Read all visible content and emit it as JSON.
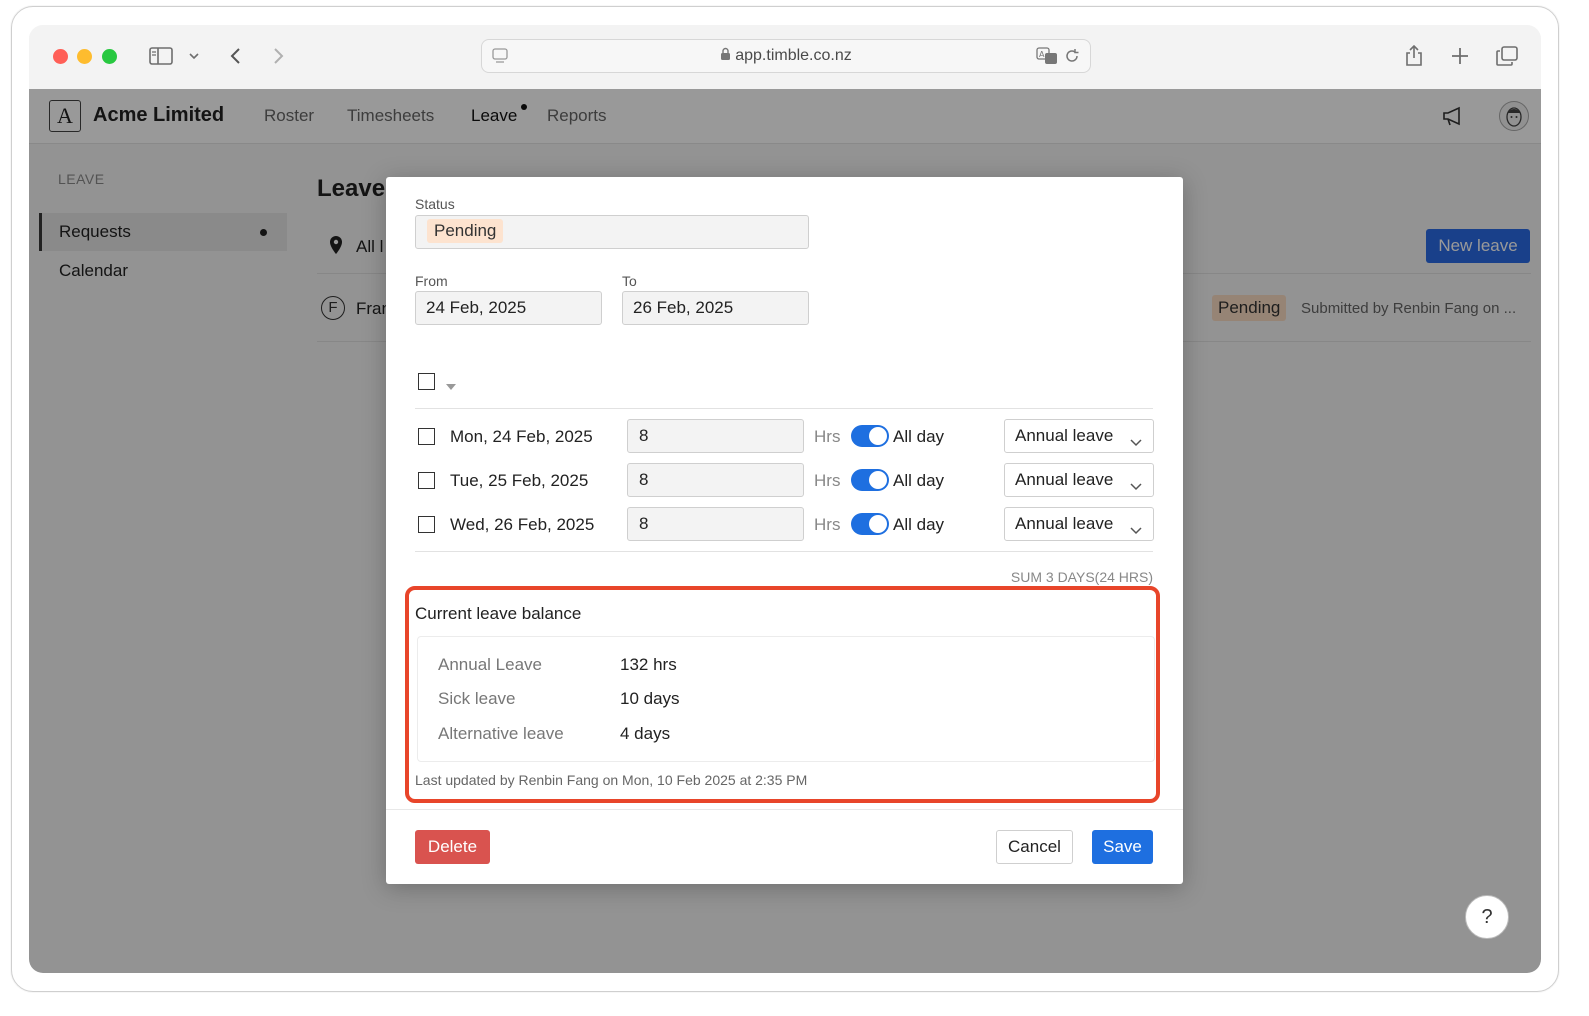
{
  "browser": {
    "url": "app.timble.co.nz",
    "traffic_colors": {
      "close": "#ff5f57",
      "minimize": "#febc2e",
      "maximize": "#28c840"
    }
  },
  "app": {
    "logo_letter": "A",
    "company": "Acme Limited",
    "nav": [
      "Roster",
      "Timesheets",
      "Leave",
      "Reports"
    ],
    "active_nav": "Leave"
  },
  "sidebar": {
    "heading": "LEAVE",
    "items": [
      {
        "label": "Requests",
        "active": true
      },
      {
        "label": "Calendar",
        "active": false
      }
    ]
  },
  "background_page": {
    "title": "Leave",
    "filter_label": "All l",
    "new_leave_button": "New leave",
    "row": {
      "avatar_letter": "F",
      "name": "Fran",
      "status": "Pending",
      "submitted": "Submitted by Renbin Fang on ..."
    }
  },
  "modal": {
    "status_label": "Status",
    "status_value": "Pending",
    "from_label": "From",
    "from_value": "24 Feb, 2025",
    "to_label": "To",
    "to_value": "26 Feb, 2025",
    "days": [
      {
        "date": "Mon, 24 Feb, 2025",
        "hours": "8",
        "hrs_label": "Hrs",
        "all_day": "All day",
        "type": "Annual leave"
      },
      {
        "date": "Tue, 25 Feb, 2025",
        "hours": "8",
        "hrs_label": "Hrs",
        "all_day": "All day",
        "type": "Annual leave"
      },
      {
        "date": "Wed, 26 Feb, 2025",
        "hours": "8",
        "hrs_label": "Hrs",
        "all_day": "All day",
        "type": "Annual leave"
      }
    ],
    "sum": "SUM 3 DAYS(24 HRS)",
    "balance_title": "Current leave balance",
    "balances": [
      {
        "name": "Annual Leave",
        "value": "132 hrs"
      },
      {
        "name": "Sick leave",
        "value": "10 days"
      },
      {
        "name": "Alternative leave",
        "value": "4 days"
      }
    ],
    "last_updated": "Last updated by Renbin Fang on Mon, 10 Feb 2025 at 2:35 PM",
    "buttons": {
      "delete": "Delete",
      "cancel": "Cancel",
      "save": "Save"
    }
  },
  "help_button": "?",
  "accent_colors": {
    "primary": "#1e6fe0",
    "danger": "#d9534f",
    "highlight": "#e8452a",
    "pending": "#fde3cf"
  }
}
